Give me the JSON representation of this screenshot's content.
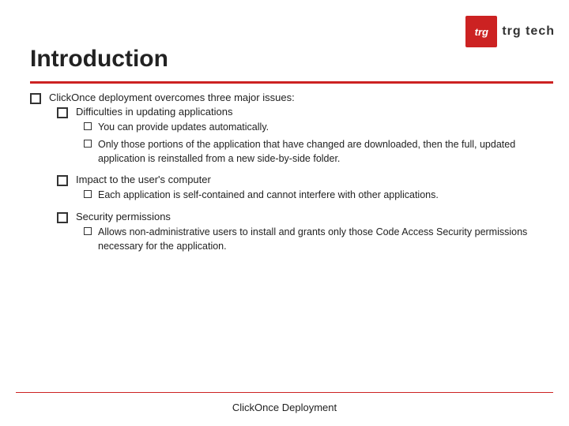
{
  "header": {
    "logo_text": "trg",
    "logo_subtitle": "trg tech"
  },
  "slide": {
    "title": "Introduction"
  },
  "content": {
    "intro": "ClickOnce deployment overcomes three major issues:",
    "items": [
      {
        "title": "Difficulties in updating applications",
        "subitems": [
          "You can provide updates automatically.",
          "Only those portions of the application that have changed are downloaded, then the full, updated application is reinstalled from a new side-by-side folder."
        ]
      },
      {
        "title": "Impact to the user's computer",
        "subitems": [
          "Each application is self-contained and cannot interfere with other applications."
        ]
      },
      {
        "title": "Security permissions",
        "subitems": [
          "Allows non-administrative users to install and grants only those Code Access Security permissions necessary for the application."
        ]
      }
    ]
  },
  "footer": {
    "label": "ClickOnce Deployment"
  }
}
